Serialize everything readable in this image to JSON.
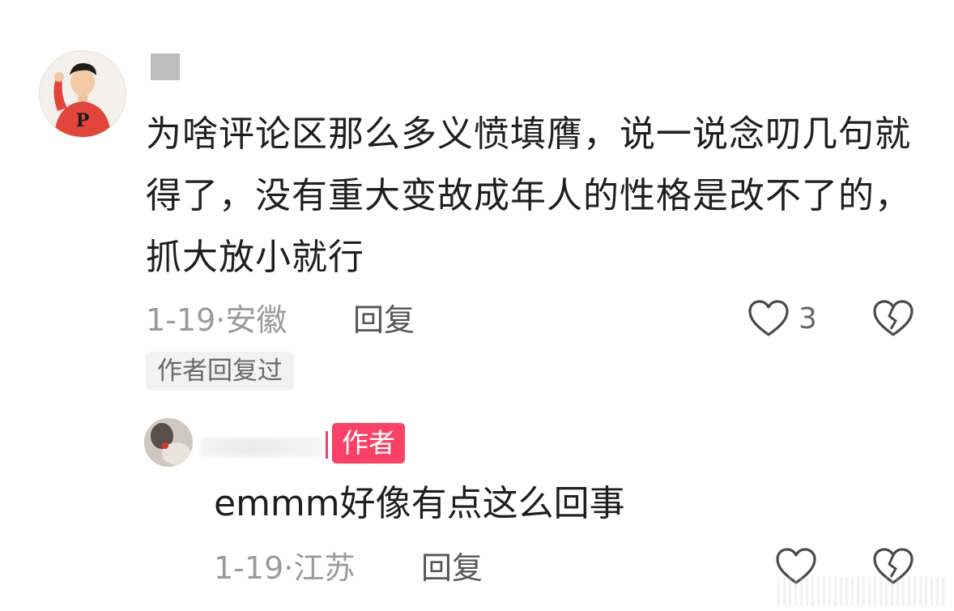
{
  "comment": {
    "text": "为啥评论区那么多义愤填膺，说一说念叨几句就得了，没有重大变故成年人的性格是改不了的，抓大放小就行",
    "date": "1-19",
    "location": "安徽",
    "separator": "·",
    "reply_label": "回复",
    "like_count": "3",
    "author_replied_tag": "作者回复过",
    "avatar_letter": "P"
  },
  "reply": {
    "author_badge": "作者",
    "text": "emmm好像有点这么回事",
    "date": "1-19",
    "location": "江苏",
    "separator": "·",
    "reply_label": "回复"
  },
  "colors": {
    "badge": "#fb4266",
    "meta": "#9b9b9b",
    "text": "#1f1f1f",
    "redacted": "#bdbdbd"
  }
}
